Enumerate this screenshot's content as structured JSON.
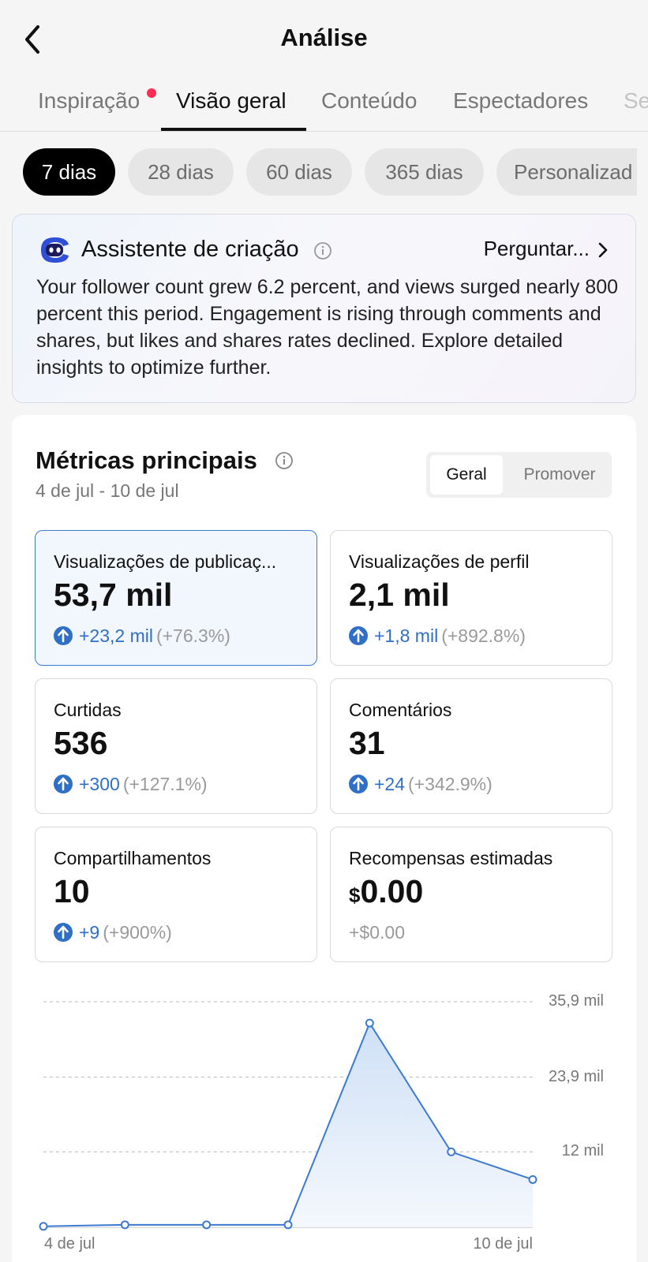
{
  "header": {
    "title": "Análise"
  },
  "tabs": [
    {
      "label": "Inspiração"
    },
    {
      "label": "Visão geral"
    },
    {
      "label": "Conteúdo"
    },
    {
      "label": "Espectadores"
    },
    {
      "label": "Se"
    }
  ],
  "periods": [
    {
      "label": "7 dias"
    },
    {
      "label": "28 dias"
    },
    {
      "label": "60 dias"
    },
    {
      "label": "365 dias"
    },
    {
      "label": "Personalizad"
    }
  ],
  "assistant": {
    "title": "Assistente de criação",
    "ask_label": "Perguntar...",
    "summary": "Your follower count grew 6.2 percent, and views surged nearly 800 percent this period. Engagement is rising through comments and shares, but likes and shares rates declined. Explore detailed insights to optimize further."
  },
  "metrics": {
    "title": "Métricas principais",
    "date_range": "4 de jul - 10 de jul",
    "toggle": {
      "general": "Geral",
      "promote": "Promover"
    },
    "tiles": [
      {
        "label": "Visualizações de publicaç...",
        "value": "53,7 mil",
        "delta": "+23,2 mil",
        "pct": "(+76.3%)"
      },
      {
        "label": "Visualizações de perfil",
        "value": "2,1 mil",
        "delta": "+1,8 mil",
        "pct": "(+892.8%)"
      },
      {
        "label": "Curtidas",
        "value": "536",
        "delta": "+300",
        "pct": "(+127.1%)"
      },
      {
        "label": "Comentários",
        "value": "31",
        "delta": "+24",
        "pct": "(+342.9%)"
      },
      {
        "label": "Compartilhamentos",
        "value": "10",
        "delta": "+9",
        "pct": "(+900%)"
      },
      {
        "label": "Recompensas estimadas",
        "currency": "$",
        "value": "0.00",
        "delta_plain": "+$0.00"
      }
    ]
  },
  "chart_data": {
    "type": "area",
    "x": [
      "4 de jul",
      "5 de jul",
      "6 de jul",
      "7 de jul",
      "8 de jul",
      "9 de jul",
      "10 de jul"
    ],
    "series": [
      {
        "values": [
          150,
          400,
          400,
          400,
          32500,
          12000,
          7600
        ]
      }
    ],
    "yticks": [
      {
        "value": 12000,
        "label": "12 mil"
      },
      {
        "value": 23900,
        "label": "23,9 mil"
      },
      {
        "value": 35900,
        "label": "35,9 mil"
      }
    ],
    "xtick_labels": [
      "4 de jul",
      "10 de jul"
    ],
    "ylim": [
      0,
      35900
    ],
    "grid": true,
    "line_color": "#3d7bd0"
  }
}
